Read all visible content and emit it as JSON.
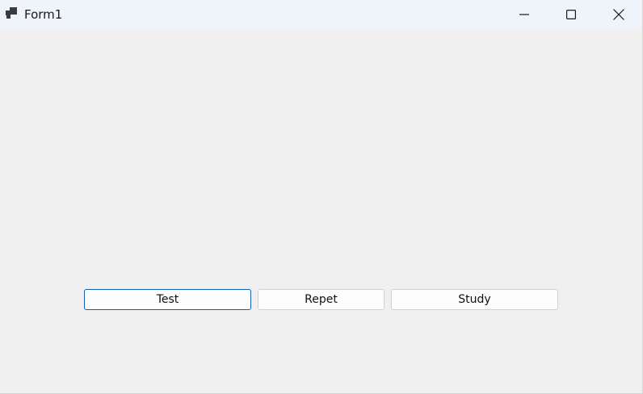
{
  "window": {
    "title": "Form1",
    "app_icon": "winforms-app-icon",
    "controls": {
      "minimize_icon": "minimize-icon",
      "maximize_icon": "maximize-icon",
      "close_icon": "close-icon"
    }
  },
  "form": {
    "buttons": [
      {
        "label": "Test",
        "focused": true
      },
      {
        "label": "Repet",
        "focused": false
      },
      {
        "label": "Study",
        "focused": false
      }
    ]
  },
  "colors": {
    "titlebar_bg": "#eff3fa",
    "client_bg": "#f0f0f0",
    "button_bg": "#fdfdfd",
    "focus_border": "#0a63b8"
  }
}
